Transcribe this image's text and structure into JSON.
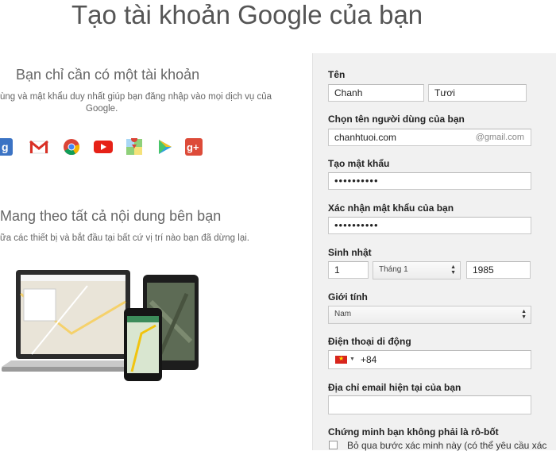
{
  "page_title": "Tạo tài khoản Google của bạn",
  "left": {
    "heading1": "Bạn chỉ cần có một tài khoản",
    "para1_line1": "ùng và mật khẩu duy nhất giúp bạn đăng nhập vào mọi dịch vụ của",
    "para1_line2": "Google.",
    "heading2": "Mang theo tất cả nội dung bên bạn",
    "para2": "ữa các thiết bị và bắt đầu tại bất cứ vị trí nào bạn đã dừng lại.",
    "icons": [
      "google-plus-icon",
      "gmail-icon",
      "chrome-icon",
      "youtube-icon",
      "maps-icon",
      "play-icon",
      "google-plus-red-icon"
    ]
  },
  "form": {
    "name_label": "Tên",
    "first_name": "Chanh",
    "last_name": "Tươi",
    "username_label": "Chọn tên người dùng của bạn",
    "username": "chanhtuoi.com",
    "username_suffix": "@gmail.com",
    "password_label": "Tạo mật khẩu",
    "password": "••••••••••",
    "confirm_label": "Xác nhận mật khẩu của bạn",
    "confirm": "••••••••••",
    "birthday_label": "Sinh nhật",
    "birth_day": "1",
    "birth_month": "Tháng 1",
    "birth_year": "1985",
    "gender_label": "Giới tính",
    "gender": "Nam",
    "phone_label": "Điện thoại di động",
    "phone_prefix": "+84",
    "email_label": "Địa chỉ email hiện tại của bạn",
    "email": "",
    "robot_label": "Chứng minh bạn không phải là rô-bốt",
    "skip_label": "Bỏ qua bước xác minh này (có thể yêu cầu xác"
  },
  "colors": {
    "form_bg": "#f1f1f1",
    "gmail_red": "#d93025",
    "youtube_red": "#e62117",
    "gplus_red": "#dd4b39",
    "gplus_blue": "#3b73c4"
  }
}
